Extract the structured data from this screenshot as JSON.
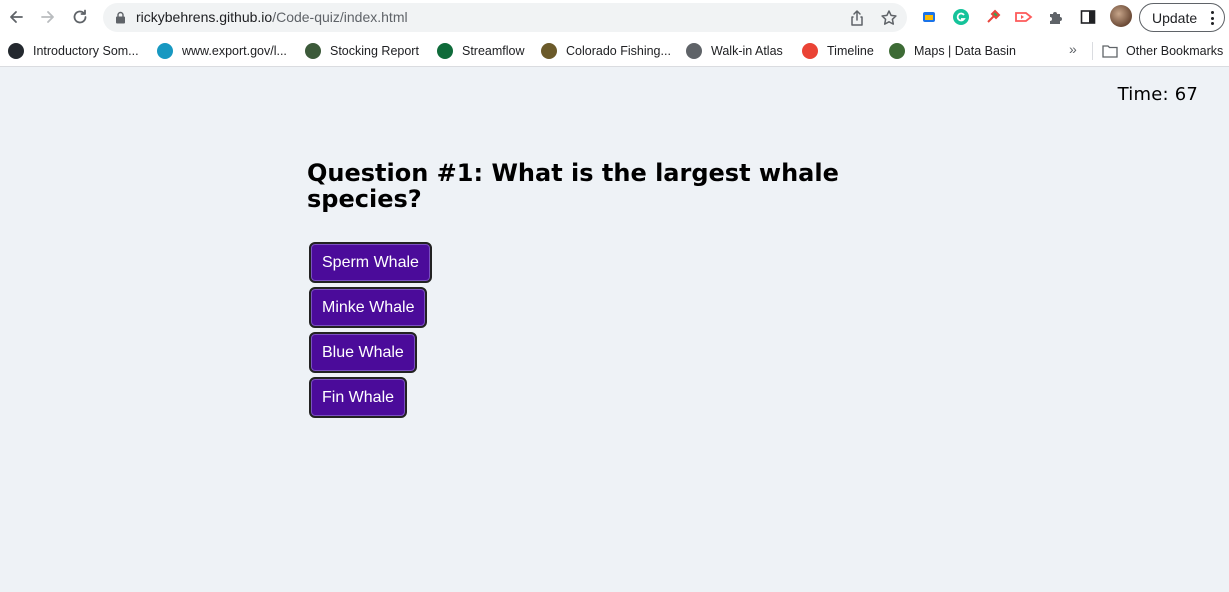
{
  "browser": {
    "url_domain": "rickybehrens.github.io",
    "url_path": "/Code-quiz/index.html",
    "update_label": "Update",
    "bookmarks": [
      {
        "label": "Introductory Som...",
        "icon": "github-icon",
        "color": "#24292f"
      },
      {
        "label": "www.export.gov/l...",
        "icon": "salesforce-cloud-icon",
        "color": "#1798c1"
      },
      {
        "label": "Stocking Report",
        "icon": "seal-icon",
        "color": "#3c5a3a"
      },
      {
        "label": "Streamflow",
        "icon": "streamflow-icon",
        "color": "#0f6b3a"
      },
      {
        "label": "Colorado Fishing...",
        "icon": "cpw-icon",
        "color": "#6b5a2a"
      },
      {
        "label": "Walk-in Atlas",
        "icon": "globe-icon",
        "color": "#5f6368"
      },
      {
        "label": "Timeline",
        "icon": "maps-pin-icon",
        "color": "#ea4335"
      },
      {
        "label": "Maps | Data Basin",
        "icon": "leaf-icon",
        "color": "#3d6b35"
      }
    ],
    "more_label": "»",
    "other_bookmarks_label": "Other Bookmarks"
  },
  "quiz": {
    "timer": "Time: 67",
    "question": "Question #1: What is the largest whale species?",
    "answers": [
      "Sperm Whale",
      "Minke Whale",
      "Blue Whale",
      "Fin Whale"
    ]
  },
  "colors": {
    "answer_bg": "#4b0b9a",
    "page_bg": "#eef2f6"
  }
}
